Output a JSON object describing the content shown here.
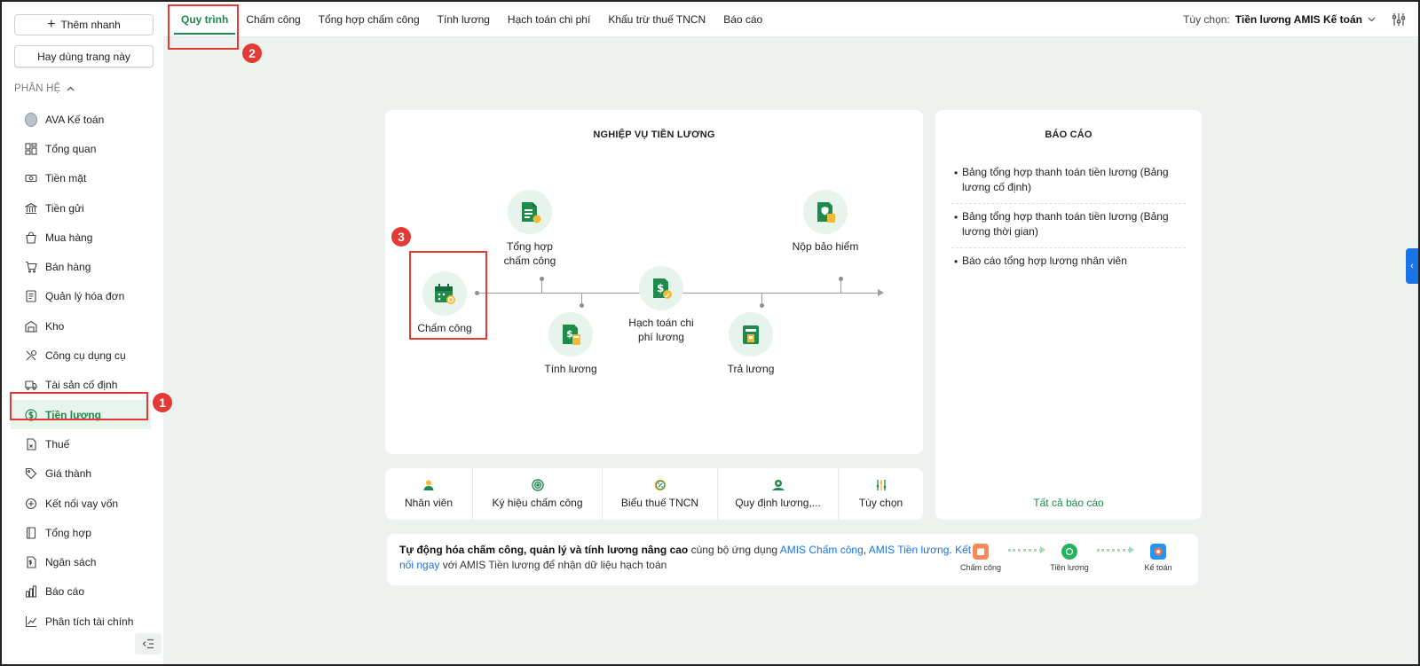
{
  "sidebar": {
    "quick_add": "Thêm nhanh",
    "favorite": "Hay dùng trang này",
    "section_title": "PHÂN HỆ",
    "items": [
      {
        "label": "AVA Kế toán",
        "icon": "avatar"
      },
      {
        "label": "Tổng quan",
        "icon": "dashboard-icon"
      },
      {
        "label": "Tiền mặt",
        "icon": "cash-icon"
      },
      {
        "label": "Tiền gửi",
        "icon": "bank-icon"
      },
      {
        "label": "Mua hàng",
        "icon": "shopping-bag-icon"
      },
      {
        "label": "Bán hàng",
        "icon": "cart-icon"
      },
      {
        "label": "Quản lý hóa đơn",
        "icon": "invoice-icon"
      },
      {
        "label": "Kho",
        "icon": "warehouse-icon"
      },
      {
        "label": "Công cụ dụng cụ",
        "icon": "tools-icon"
      },
      {
        "label": "Tài sản cố định",
        "icon": "truck-icon"
      },
      {
        "label": "Tiền lương",
        "icon": "dollar-circle-icon"
      },
      {
        "label": "Thuế",
        "icon": "tax-doc-icon"
      },
      {
        "label": "Giá thành",
        "icon": "tag-icon"
      },
      {
        "label": "Kết nối vay vốn",
        "icon": "link-icon"
      },
      {
        "label": "Tổng hợp",
        "icon": "book-icon"
      },
      {
        "label": "Ngân sách",
        "icon": "budget-icon"
      },
      {
        "label": "Báo cáo",
        "icon": "bar-chart-icon"
      },
      {
        "label": "Phân tích tài chính",
        "icon": "analytics-icon"
      }
    ]
  },
  "topbar": {
    "tabs": [
      "Quy trình",
      "Chấm công",
      "Tổng hợp chấm công",
      "Tính lương",
      "Hạch toán chi phí",
      "Khấu trừ thuế TNCN",
      "Báo cáo"
    ],
    "option_label": "Tùy chọn:",
    "option_value": "Tiền lương AMIS Kế toán"
  },
  "process": {
    "title": "NGHIỆP VỤ TIỀN LƯƠNG",
    "nodes": {
      "cham_cong": "Chấm công",
      "tong_hop": "Tổng hợp chấm công",
      "tinh_luong": "Tính lương",
      "hach_toan": "Hạch toán chi phí lương",
      "tra_luong": "Trả lương",
      "nop_bao_hiem": "Nộp bảo hiểm"
    }
  },
  "tools": [
    "Nhân viên",
    "Ký hiệu chấm công",
    "Biểu thuế TNCN",
    "Quy định lương,...",
    "Tùy chọn"
  ],
  "reports": {
    "title": "BÁO CÁO",
    "items": [
      "Bảng tổng hợp thanh toán tiền lương (Bảng lương cố định)",
      "Bảng tổng hợp thanh toán tiền lương (Bảng lương thời gian)",
      "Báo cáo tổng hợp lương nhân viên"
    ],
    "all": "Tất cả báo cáo"
  },
  "promo": {
    "bold": "Tự động hóa chấm công, quản lý và tính lương nâng cao",
    "t1": " cùng bộ ứng dụng ",
    "link1": "AMIS Chấm công",
    "sep": ", ",
    "link2": "AMIS Tiền lương",
    "dot": ". ",
    "link3": "Kết nối ngay",
    "t2": " với AMIS Tiền lương để nhận dữ liệu hạch toán",
    "flow": [
      "Chấm công",
      "Tiền lương",
      "Kế toán"
    ]
  },
  "markers": [
    "1",
    "2",
    "3"
  ],
  "colors": {
    "accent": "#1e8a4c",
    "highlight": "#e53935",
    "link": "#1a73e8"
  }
}
